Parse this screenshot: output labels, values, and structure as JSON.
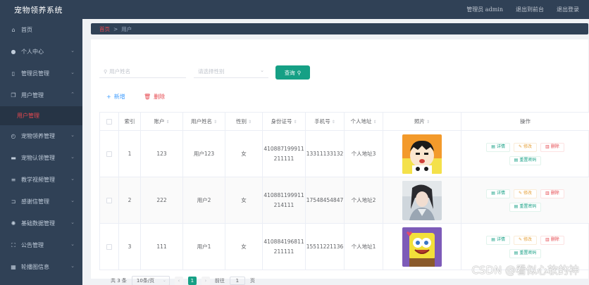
{
  "app": {
    "title": "宠物领养系统"
  },
  "header": {
    "user": "管理员 admin",
    "back_front": "退出到前台",
    "logout": "退出登录"
  },
  "sidebar": {
    "items": [
      {
        "label": "首页",
        "icon": "home-icon",
        "glyph": "⌂",
        "chev": ""
      },
      {
        "label": "个人中心",
        "icon": "user-icon",
        "glyph": "●",
        "chev": "⌄"
      },
      {
        "label": "管理员管理",
        "icon": "phone-icon",
        "glyph": "▯",
        "chev": "⌄"
      },
      {
        "label": "用户管理",
        "icon": "copy-icon",
        "glyph": "❐",
        "chev": "⌃"
      },
      {
        "label": "用户管理",
        "sub": true
      },
      {
        "label": "宠物领养管理",
        "icon": "compass-icon",
        "glyph": "◴",
        "chev": "⌄"
      },
      {
        "label": "宠物认领管理",
        "icon": "suitcase-icon",
        "glyph": "▬",
        "chev": "⌄"
      },
      {
        "label": "教学视频管理",
        "icon": "menu-icon",
        "glyph": "≡",
        "chev": "⌄"
      },
      {
        "label": "感谢信管理",
        "icon": "crop-icon",
        "glyph": "⊐",
        "chev": "⌄"
      },
      {
        "label": "基础数据管理",
        "icon": "settings-icon",
        "glyph": "✺",
        "chev": "⌄"
      },
      {
        "label": "公告管理",
        "icon": "fullscreen-icon",
        "glyph": "⛶",
        "chev": "⌄"
      },
      {
        "label": "轮播图信息",
        "icon": "grid-icon",
        "glyph": "▦",
        "chev": "⌄"
      }
    ]
  },
  "breadcrumb": {
    "home": "首页",
    "sep": ">",
    "current": "用户"
  },
  "search": {
    "name_placeholder": "用户姓名",
    "gender_placeholder": "请选择性别",
    "query_label": "查询"
  },
  "actions": {
    "add_label": "新增",
    "delete_label": "删除"
  },
  "table": {
    "columns": [
      "索引",
      "账户",
      "用户姓名",
      "性别",
      "身份证号",
      "手机号",
      "个人地址",
      "照片",
      "操作"
    ],
    "rows": [
      {
        "index": "1",
        "account": "123",
        "name": "用户123",
        "gender": "女",
        "id_line1": "410887199911",
        "id_line2": "211111",
        "phone": "13311133132",
        "address": "个人地址3"
      },
      {
        "index": "2",
        "account": "222",
        "name": "用户2",
        "gender": "女",
        "id_line1": "410881199911",
        "id_line2": "214111",
        "phone": "17548454847",
        "address": "个人地址2"
      },
      {
        "index": "3",
        "account": "111",
        "name": "用户1",
        "gender": "女",
        "id_line1": "410884196811",
        "id_line2": "211111",
        "phone": "15511221136",
        "address": "个人地址1"
      }
    ],
    "ops": {
      "detail": "详情",
      "edit": "修改",
      "remove": "删除",
      "reset": "重置密码"
    }
  },
  "pagination": {
    "total": "共 3 条",
    "page_size": "10条/页",
    "current_page": "1",
    "goto_label": "前往",
    "goto_value": "1",
    "page_unit": "页"
  },
  "watermark": "CSDN @看似心软的神",
  "colors": {
    "sidebar_bg": "#304156",
    "accent": "#16a085",
    "danger": "#e6484f",
    "warning": "#e6a23c",
    "link": "#409eff"
  }
}
